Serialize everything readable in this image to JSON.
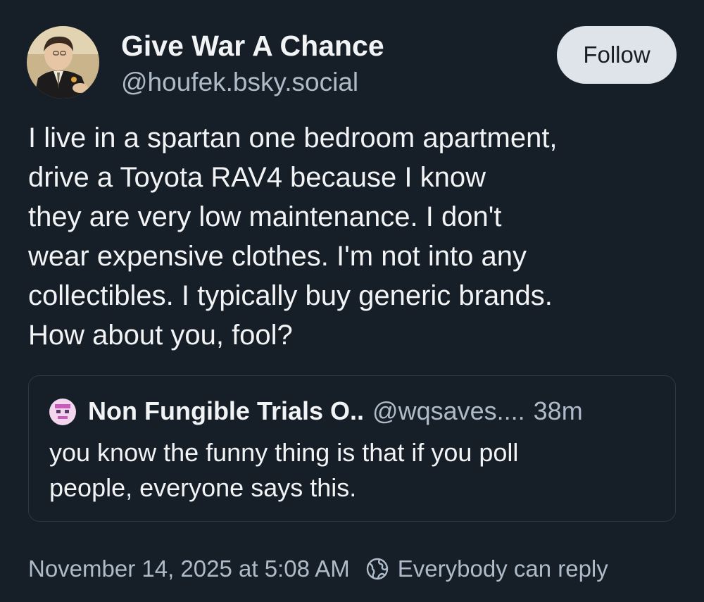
{
  "author": {
    "name": "Give War A Chance",
    "handle": "@houfek.bsky.social",
    "follow_label": "Follow"
  },
  "post": {
    "text_lines": [
      "I live in a spartan one bedroom apartment,",
      "drive a Toyota RAV4 because I know",
      "they are very low maintenance. I don't",
      "wear expensive clothes. I'm not into any",
      "collectibles. I typically buy generic brands.",
      "How about you, fool?"
    ]
  },
  "quote": {
    "name": "Non Fungible Trials O..",
    "handle": "@wqsaves....",
    "time": "38m",
    "text_lines": [
      "you know the funny thing is that if you poll",
      "people, everyone says this."
    ]
  },
  "footer": {
    "timestamp": "November 14, 2025 at 5:08 AM",
    "reply_setting": "Everybody can reply"
  },
  "colors": {
    "background": "#161e27",
    "text_primary": "#f1f3f5",
    "text_secondary": "#aebbc9",
    "follow_button_bg": "#dfe4ea",
    "quote_border": "#2c3844"
  },
  "icons": {
    "reply_setting_icon": "globe-icon"
  }
}
